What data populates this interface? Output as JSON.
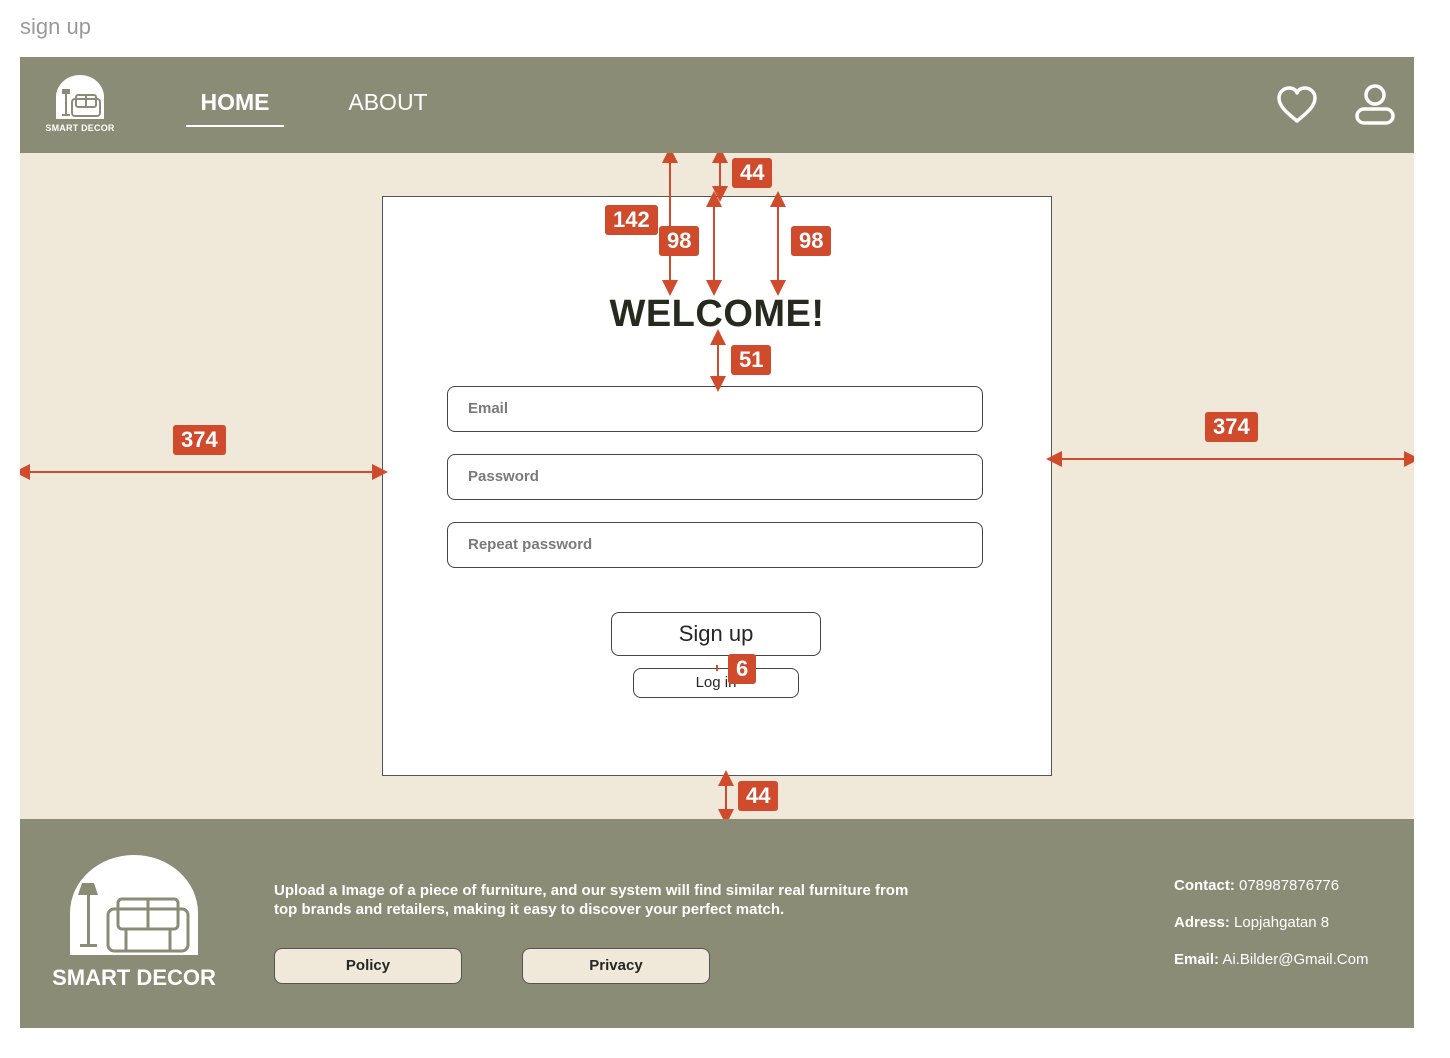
{
  "frame_label": "sign up",
  "header": {
    "brand": "SMART DECOR",
    "nav": {
      "home": "HOME",
      "about": "ABOUT"
    },
    "icons": [
      "logo-icon",
      "heart-icon",
      "user-icon"
    ]
  },
  "card": {
    "title": "WELCOME!",
    "email_placeholder": "Email",
    "password_placeholder": "Password",
    "repeat_password_placeholder": "Repeat password",
    "signup_label": "Sign up",
    "login_label": "Log in"
  },
  "annotations": {
    "top_gap": "44",
    "total_height": "142",
    "left_pad": "98",
    "right_pad": "98",
    "title_gap": "51",
    "left_margin": "374",
    "right_margin": "374",
    "button_gap": "6",
    "bottom_gap": "44"
  },
  "footer": {
    "brand": "SMART DECOR",
    "description": "Upload a Image of a piece of furniture, and our system will find similar real furniture from top brands and retailers, making it easy to discover your perfect match.",
    "policy_label": "Policy",
    "privacy_label": "Privacy",
    "contact_label": "Contact:",
    "contact_value": "078987876776",
    "address_label": "Adress:",
    "address_value": "Lopjahgatan 8",
    "email_label": "Email:",
    "email_value": "Ai.Bilder@Gmail.Com"
  },
  "colors": {
    "header_bg": "#8a8c76",
    "page_bg": "#f0e9d9",
    "accent_annotation": "#d04a2c",
    "title_text": "#262a1d"
  }
}
